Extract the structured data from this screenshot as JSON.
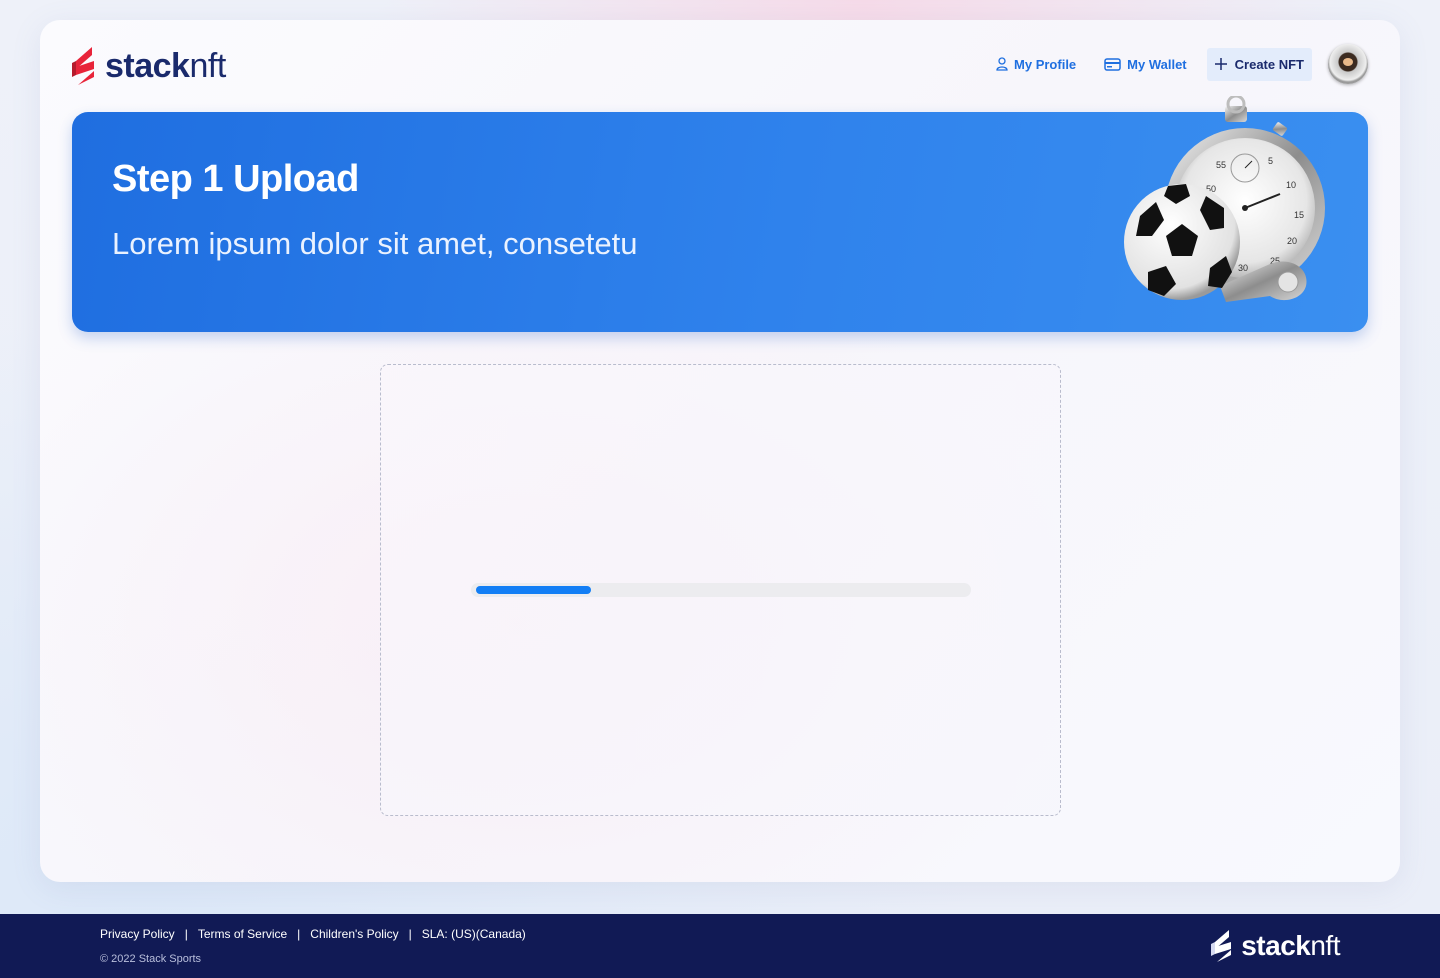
{
  "header": {
    "logo_bold": "stack",
    "logo_light": "nft",
    "nav": {
      "profile_label": "My Profile",
      "wallet_label": "My Wallet",
      "create_label": "Create NFT"
    },
    "icons": {
      "profile": "user-icon",
      "wallet": "credit-card-icon",
      "create": "plus-icon",
      "avatar": "avatar"
    }
  },
  "banner": {
    "title": "Step 1 Upload",
    "subtitle": "Lorem ipsum dolor sit amet, consetetu",
    "art": "stopwatch-soccer-ball-whistle-illustration"
  },
  "upload": {
    "progress_fraction": 0.235
  },
  "footer": {
    "links": [
      "Privacy Policy",
      "Terms of Service",
      "Children's Policy",
      "SLA: (US)(Canada)"
    ],
    "separator": "|",
    "copyright": "© 2022 Stack Sports",
    "logo_bold": "stack",
    "logo_light": "nft"
  },
  "colors": {
    "brand_navy": "#1a2a6c",
    "accent_blue": "#1f6fe0",
    "logo_red": "#e8243a",
    "footer_bg": "#111a55",
    "progress_fill": "#137ef5"
  }
}
